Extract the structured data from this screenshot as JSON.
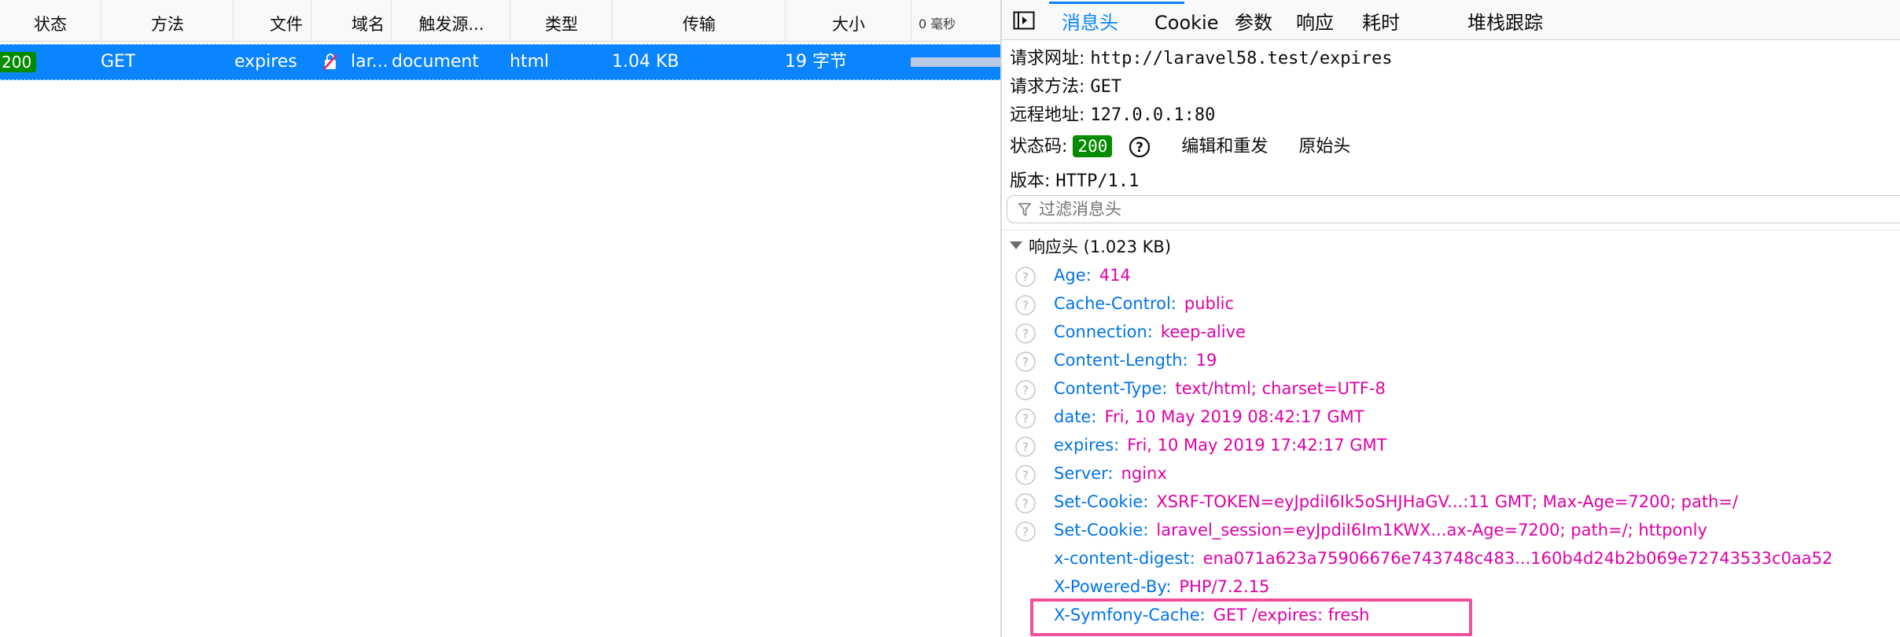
{
  "request_list": {
    "columns": [
      {
        "label": "状态"
      },
      {
        "label": "方法"
      },
      {
        "label": "文件"
      },
      {
        "label": "域名"
      },
      {
        "label": "触发源..."
      },
      {
        "label": "类型"
      },
      {
        "label": "传输"
      },
      {
        "label": "大小"
      },
      {
        "label": "0 毫秒"
      }
    ],
    "row": {
      "status": "200",
      "method": "GET",
      "file": "expires",
      "domain": "lar...",
      "cause": "document",
      "type": "html",
      "transferred": "1.04 KB",
      "size": "19 字节"
    }
  },
  "details": {
    "tabs": [
      {
        "label": "消息头"
      },
      {
        "label": "Cookie"
      },
      {
        "label": "参数"
      },
      {
        "label": "响应"
      },
      {
        "label": "耗时"
      },
      {
        "label": "堆栈跟踪"
      }
    ],
    "summary": {
      "url_label": "请求网址:",
      "url_value": "http://laravel58.test/expires",
      "method_label": "请求方法:",
      "method_value": "GET",
      "remote_label": "远程地址:",
      "remote_value": "127.0.0.1:80",
      "status_label": "状态码:",
      "status_value": "200",
      "edit_resend": "编辑和重发",
      "raw_headers": "原始头",
      "version_label": "版本:",
      "version_value": "HTTP/1.1"
    },
    "filter_placeholder": "过滤消息头",
    "response_headers_title": "响应头 (1.023 KB)",
    "headers": [
      {
        "name": "Age:",
        "value": "414"
      },
      {
        "name": "Cache-Control:",
        "value": "public"
      },
      {
        "name": "Connection:",
        "value": "keep-alive"
      },
      {
        "name": "Content-Length:",
        "value": "19"
      },
      {
        "name": "Content-Type:",
        "value": "text/html; charset=UTF-8"
      },
      {
        "name": "date:",
        "value": "Fri, 10 May 2019 08:42:17 GMT"
      },
      {
        "name": "expires:",
        "value": "Fri, 10 May 2019 17:42:17 GMT"
      },
      {
        "name": "Server:",
        "value": "nginx"
      },
      {
        "name": "Set-Cookie:",
        "value": "XSRF-TOKEN=eyJpdiI6Ik5oSHJHaGV...:11 GMT; Max-Age=7200; path=/"
      },
      {
        "name": "Set-Cookie:",
        "value": "laravel_session=eyJpdiI6Im1KWX...ax-Age=7200; path=/; httponly"
      },
      {
        "name": "x-content-digest:",
        "value": "ena071a623a75906676e743748c483...160b4d24b2b069e72743533c0aa52"
      },
      {
        "name": "X-Powered-By:",
        "value": "PHP/7.2.15"
      },
      {
        "name": "X-Symfony-Cache:",
        "value": "GET /expires: fresh"
      }
    ]
  },
  "colors": {
    "accent": "#0a84ff",
    "status_ok": "#058b00",
    "header_name": "#0074e8",
    "header_value": "#dd00a9",
    "highlight_box": "#f0509b"
  }
}
